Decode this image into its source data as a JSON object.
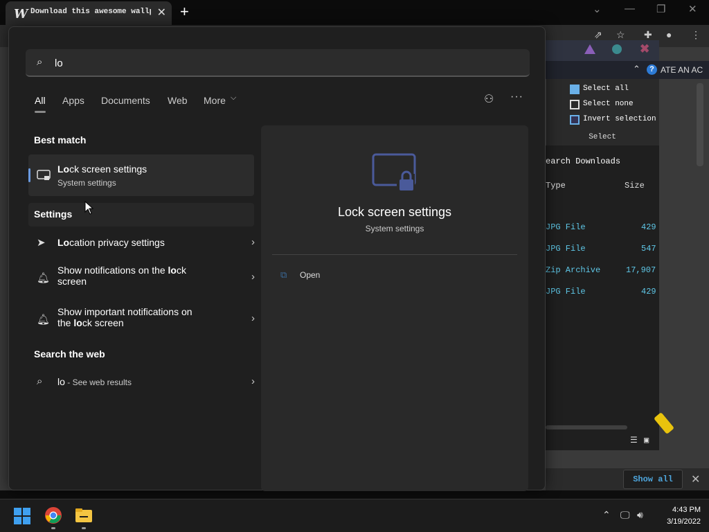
{
  "browser": {
    "tab_title": "Download this awesome wallpaper",
    "favicon": "W",
    "new_tab": "+",
    "close_tab": "✕",
    "toolbar_icons": [
      "share-icon",
      "star-icon",
      "extensions-icon",
      "profile-icon",
      "menu-icon"
    ]
  },
  "background_app": {
    "header_text": "ATE AN AC",
    "ribbon": {
      "select_all": "Select all",
      "select_none": "Select none",
      "invert_selection": "Invert selection",
      "group_label": "Select"
    },
    "file_list": {
      "search_label": "earch Downloads",
      "columns": [
        "Type",
        "Size"
      ],
      "rows": [
        {
          "type": "JPG File",
          "size": "429"
        },
        {
          "type": "JPG File",
          "size": "547"
        },
        {
          "type": "Zip Archive",
          "size": "17,907"
        },
        {
          "type": "JPG File",
          "size": "429"
        }
      ]
    },
    "notification": {
      "show_all": "Show all",
      "close": "✕"
    }
  },
  "search": {
    "query": "lo",
    "filters": [
      "All",
      "Apps",
      "Documents",
      "Web",
      "More"
    ],
    "more_chevron": "⌵",
    "more_options": "···"
  },
  "results": {
    "best_match_header": "Best match",
    "best_match": {
      "title_bold": "Lo",
      "title_rest": "ck screen settings",
      "subtitle": "System settings"
    },
    "settings_header": "Settings",
    "settings": [
      {
        "pre": "",
        "bold": "Lo",
        "post": "cation privacy settings",
        "line2": ""
      },
      {
        "pre": "Show notifications on the ",
        "bold": "lo",
        "post": "ck",
        "line2": "screen"
      },
      {
        "pre": "Show important notifications on",
        "bold": "",
        "post": "",
        "line2_pre": "the ",
        "line2_bold": "lo",
        "line2_post": "ck screen"
      }
    ],
    "web_header": "Search the web",
    "web": {
      "query": "lo",
      "suffix": " - See web results"
    }
  },
  "preview": {
    "title": "Lock screen settings",
    "subtitle": "System settings",
    "action": "Open"
  },
  "taskbar": {
    "time": "4:43 PM",
    "date": "3/19/2022",
    "tray_icons": [
      "chevron-up-icon",
      "network-icon",
      "volume-icon"
    ]
  },
  "colors": {
    "accent": "#4ea6dd",
    "panel": "#1f1f1f",
    "preview": "#292929"
  }
}
